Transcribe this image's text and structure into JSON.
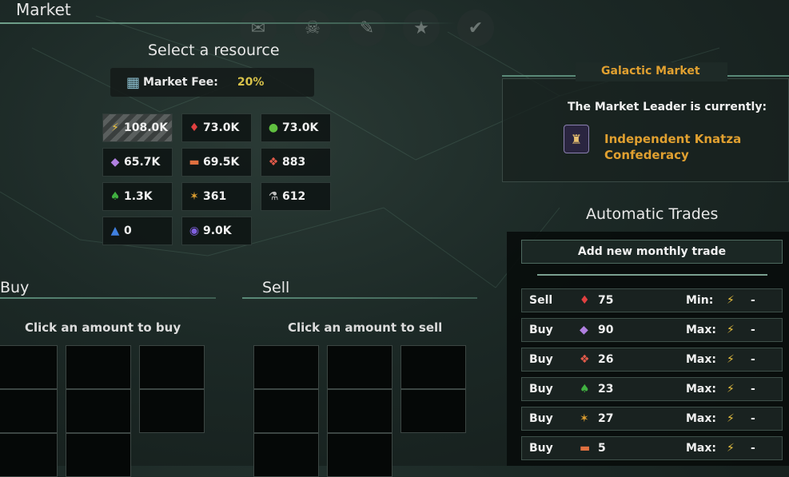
{
  "window": {
    "title": "Market"
  },
  "top_icons": [
    "diplomacy-icon",
    "skull-icon",
    "edict-icon",
    "star-icon",
    "planet-check-icon"
  ],
  "select_resource": {
    "heading": "Select a resource",
    "fee_label": "Market Fee:",
    "fee_value": "20%",
    "resources": [
      {
        "icon": "energy-icon",
        "glyph": "⚡",
        "color": "#e8c040",
        "value": "108.0K",
        "selected": true
      },
      {
        "icon": "minerals-icon",
        "glyph": "♦",
        "color": "#e04040",
        "value": "73.0K",
        "selected": false
      },
      {
        "icon": "food-icon",
        "glyph": "●",
        "color": "#60c040",
        "value": "73.0K",
        "selected": false
      },
      {
        "icon": "alloys-icon",
        "glyph": "◆",
        "color": "#b080e0",
        "value": "65.7K",
        "selected": false
      },
      {
        "icon": "consumer-goods-icon",
        "glyph": "▬",
        "color": "#e07040",
        "value": "69.5K",
        "selected": false
      },
      {
        "icon": "exotic-gases-icon",
        "glyph": "❖",
        "color": "#e05a4a",
        "value": "883",
        "selected": false
      },
      {
        "icon": "volatile-motes-icon",
        "glyph": "♠",
        "color": "#40b040",
        "value": "1.3K",
        "selected": false
      },
      {
        "icon": "rare-crystals-icon",
        "glyph": "✶",
        "color": "#e0a030",
        "value": "361",
        "selected": false
      },
      {
        "icon": "zro-icon",
        "glyph": "⚗",
        "color": "#c0c0c0",
        "value": "612",
        "selected": false
      },
      {
        "icon": "living-metal-icon",
        "glyph": "▲",
        "color": "#4080e0",
        "value": "0",
        "selected": false
      },
      {
        "icon": "dark-matter-icon",
        "glyph": "◉",
        "color": "#8060e0",
        "value": "9.0K",
        "selected": false
      }
    ]
  },
  "buy": {
    "title": "Buy",
    "hint": "Click an amount to buy"
  },
  "sell": {
    "title": "Sell",
    "hint": "Click an amount to sell"
  },
  "galactic_market": {
    "title": "Galactic Market",
    "leader_label": "The Market Leader is currently:",
    "leader_line1": "Independent Knatza",
    "leader_line2": "Confederacy"
  },
  "automatic_trades": {
    "title": "Automatic Trades",
    "add_button": "Add new monthly trade",
    "rows": [
      {
        "type": "Sell",
        "icon": "minerals-icon",
        "glyph": "♦",
        "color": "#e04040",
        "amount": "75",
        "limit": "Min:",
        "value": "-"
      },
      {
        "type": "Buy",
        "icon": "alloys-icon",
        "glyph": "◆",
        "color": "#b080e0",
        "amount": "90",
        "limit": "Max:",
        "value": "-"
      },
      {
        "type": "Buy",
        "icon": "exotic-gases-icon",
        "glyph": "❖",
        "color": "#e05a4a",
        "amount": "26",
        "limit": "Max:",
        "value": "-"
      },
      {
        "type": "Buy",
        "icon": "volatile-motes-icon",
        "glyph": "♠",
        "color": "#40b040",
        "amount": "23",
        "limit": "Max:",
        "value": "-"
      },
      {
        "type": "Buy",
        "icon": "rare-crystals-icon",
        "glyph": "✶",
        "color": "#e0a030",
        "amount": "27",
        "limit": "Max:",
        "value": "-"
      },
      {
        "type": "Buy",
        "icon": "consumer-goods-icon",
        "glyph": "▬",
        "color": "#e07040",
        "amount": "5",
        "limit": "Max:",
        "value": "-"
      }
    ]
  },
  "colors": {
    "accent": "#e0a030",
    "fee": "#d8c24a",
    "energy": "#e8c040"
  }
}
